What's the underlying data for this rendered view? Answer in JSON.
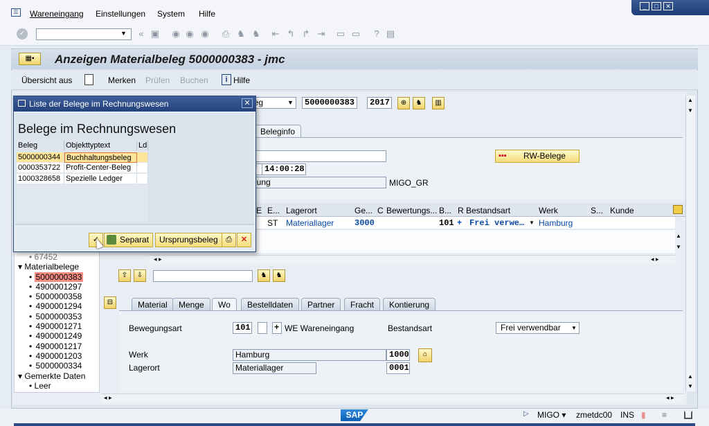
{
  "menu": {
    "items": [
      "Wareneingang",
      "Einstellungen",
      "System",
      "Hilfe"
    ]
  },
  "window": {
    "title": "Anzeigen Materialbeleg 5000000383 - jmc"
  },
  "app_toolbar": {
    "overview_off": "Übersicht aus",
    "remember": "Merken",
    "check": "Prüfen",
    "post": "Buchen",
    "help": "Hilfe"
  },
  "header": {
    "doc_type_partial": "leg",
    "doc_number": "5000000383",
    "year": "2017",
    "time": "14:00:28",
    "time_prefix": "7",
    "text_partial": "gung",
    "migo_gr": "MIGO_GR",
    "rw_button": "RW-Belege"
  },
  "tabs_header": {
    "beleginfo": "Beleginfo"
  },
  "grid": {
    "headers": [
      "E",
      "E...",
      "Lagerort",
      "Ge...",
      "C",
      "Bewertungs...",
      "B...",
      "R",
      "Bestandsart",
      "Werk",
      "S...",
      "Kunde"
    ],
    "row": {
      "e2": "ST",
      "lagerort": "Materiallager",
      "ge": "3000",
      "b": "101",
      "r": "+",
      "bestandsart": "Frei verwe…",
      "werk": "Hamburg"
    }
  },
  "tree": {
    "partial_top": "67452",
    "node_materialbelege": "Materialbelege",
    "items": [
      "5000000383",
      "4900001297",
      "5000000358",
      "4900001294",
      "5000000353",
      "4900001271",
      "4900001249",
      "4900001217",
      "4900001203",
      "5000000334"
    ],
    "node_gemerkte": "Gemerkte Daten",
    "leer": "Leer"
  },
  "detail_tabs": [
    "Material",
    "Menge",
    "Wo",
    "Bestelldaten",
    "Partner",
    "Fracht",
    "Kontierung"
  ],
  "detail": {
    "bewegungsart_label": "Bewegungsart",
    "bewegungsart_value": "101",
    "sign": "+",
    "bewegungsart_text": "WE Wareneingang",
    "bestandsart_label": "Bestandsart",
    "bestandsart_value": "Frei verwendbar",
    "werk_label": "Werk",
    "werk_value": "Hamburg",
    "werk_code": "1000",
    "lagerort_label": "Lagerort",
    "lagerort_value": "Materiallager",
    "lagerort_code": "0001"
  },
  "popup": {
    "title": "Liste der Belege im Rechnungswesen",
    "heading": "Belege im Rechnungswesen",
    "columns": [
      "Beleg",
      "Objekttyptext",
      "Ld"
    ],
    "rows": [
      {
        "beleg": "5000000344",
        "typ": "Buchhaltungsbeleg"
      },
      {
        "beleg": "0000353722",
        "typ": "Profit-Center-Beleg"
      },
      {
        "beleg": "1000328658",
        "typ": "Spezielle Ledger"
      }
    ],
    "btn_separat": "Separat",
    "btn_ursprung": "Ursprungsbeleg"
  },
  "status": {
    "sap": "SAP",
    "transaction": "MIGO",
    "server": "zmetdc00",
    "mode": "INS"
  },
  "colors": {
    "accent": "#1f3f7a",
    "selection": "#fde59b",
    "tree_selected": "#f58f84",
    "link_blue": "#0a49a6"
  }
}
